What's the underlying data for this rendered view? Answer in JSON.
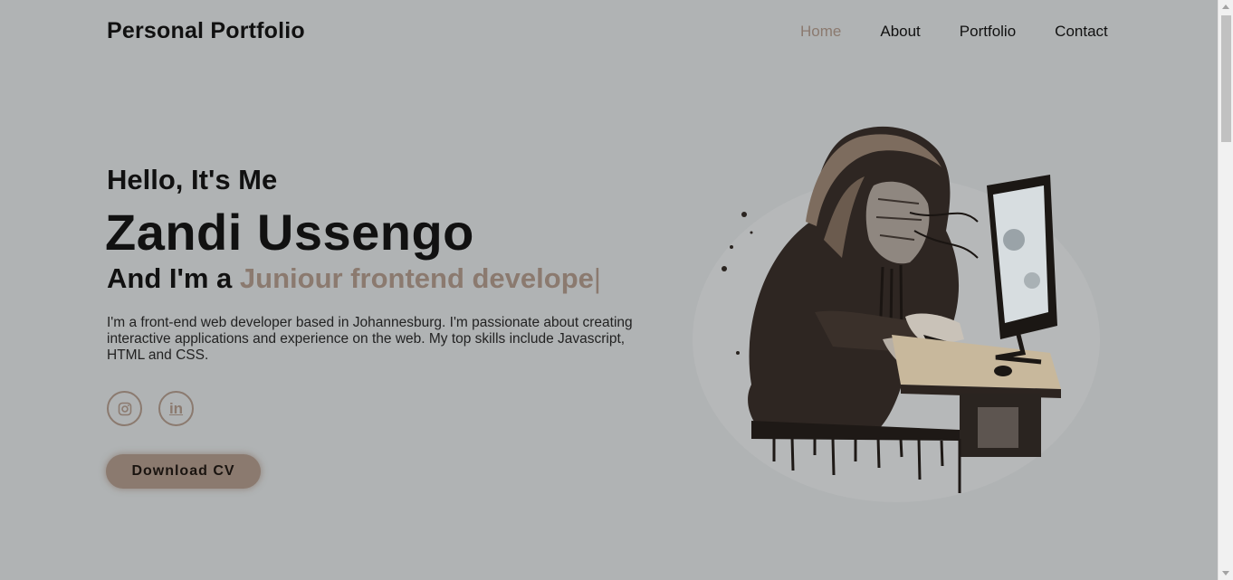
{
  "header": {
    "logo": "Personal Portfolio",
    "nav": [
      {
        "label": "Home",
        "active": true
      },
      {
        "label": "About",
        "active": false
      },
      {
        "label": "Portfolio",
        "active": false
      },
      {
        "label": "Contact",
        "active": false
      }
    ]
  },
  "hero": {
    "greeting": "Hello, It's Me",
    "name": "Zandi Ussengo",
    "role_prefix": "And I'm a",
    "role_typed": "Juniour frontend develope",
    "role_cursor": "|",
    "bio": "I'm a front-end web developer based in Johannesburg. I'm passionate about creating interactive applications and experience on the web. My top skills include Javascript, HTML and CSS.",
    "socials": [
      {
        "icon": "instagram-icon"
      },
      {
        "icon": "linkedin-icon",
        "glyph": "in"
      }
    ],
    "cv_button": "Download CV"
  },
  "colors": {
    "background": "#b0b3b4",
    "accent": "#8b7a6f",
    "text": "#111111"
  }
}
